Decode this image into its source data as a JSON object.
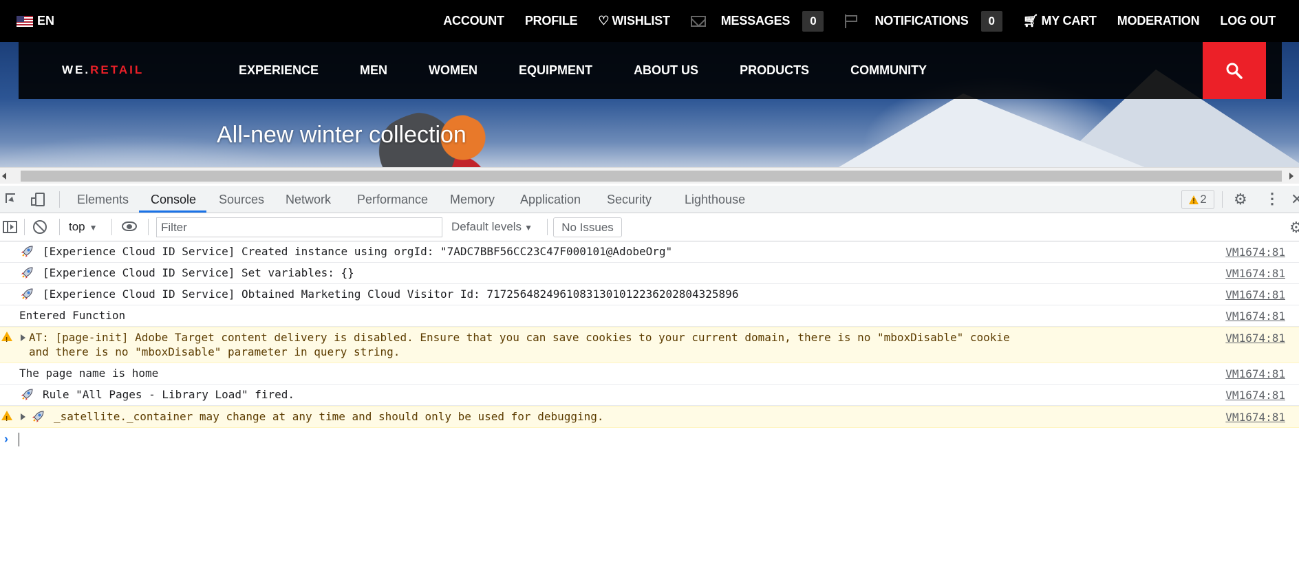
{
  "site": {
    "language": "EN",
    "top_nav": [
      {
        "label": "ACCOUNT"
      },
      {
        "label": "PROFILE"
      },
      {
        "label": "WISHLIST"
      },
      {
        "label": "MESSAGES",
        "count": "0"
      },
      {
        "label": "NOTIFICATIONS",
        "count": "0"
      },
      {
        "label": "MY CART"
      },
      {
        "label": "MODERATION"
      },
      {
        "label": "LOG OUT"
      }
    ],
    "logo": {
      "part1": "WE.",
      "part2": "RETAIL"
    },
    "main_nav": [
      "EXPERIENCE",
      "MEN",
      "WOMEN",
      "EQUIPMENT",
      "ABOUT US",
      "PRODUCTS",
      "COMMUNITY"
    ],
    "hero_title": "All-new winter collection",
    "accent_color": "#ec2028"
  },
  "devtools": {
    "tabs": [
      "Elements",
      "Console",
      "Sources",
      "Network",
      "Performance",
      "Memory",
      "Application",
      "Security",
      "Lighthouse"
    ],
    "active_tab": "Console",
    "warning_count": "2",
    "console_toolbar": {
      "context": "top",
      "filter_placeholder": "Filter",
      "levels": "Default levels",
      "issues": "No Issues"
    },
    "messages": [
      {
        "type": "rocket",
        "text": "[Experience Cloud ID Service] Created instance using orgId: \"7ADC7BBF56CC23C47F000101@AdobeOrg\"",
        "source": "VM1674:81"
      },
      {
        "type": "rocket",
        "text": "[Experience Cloud ID Service] Set variables: {}",
        "source": "VM1674:81"
      },
      {
        "type": "rocket",
        "text": "[Experience Cloud ID Service] Obtained Marketing Cloud Visitor Id: 71725648249610831301012236202804325896",
        "source": "VM1674:81"
      },
      {
        "type": "plain",
        "text": "Entered Function",
        "source": "VM1674:81"
      },
      {
        "type": "warn",
        "text": "AT: [page-init] Adobe Target content delivery is disabled. Ensure that you can save cookies to your current domain, there is no \"mboxDisable\" cookie and there is no \"mboxDisable\" parameter in query string.",
        "source": "VM1674:81"
      },
      {
        "type": "plain",
        "text": "The page name is home",
        "source": "VM1674:81"
      },
      {
        "type": "rocket",
        "text": "Rule \"All Pages - Library Load\" fired.",
        "source": "VM1674:81"
      },
      {
        "type": "warn-rocket",
        "text": "_satellite._container may change at any time and should only be used for debugging.",
        "source": "VM1674:81"
      }
    ]
  }
}
